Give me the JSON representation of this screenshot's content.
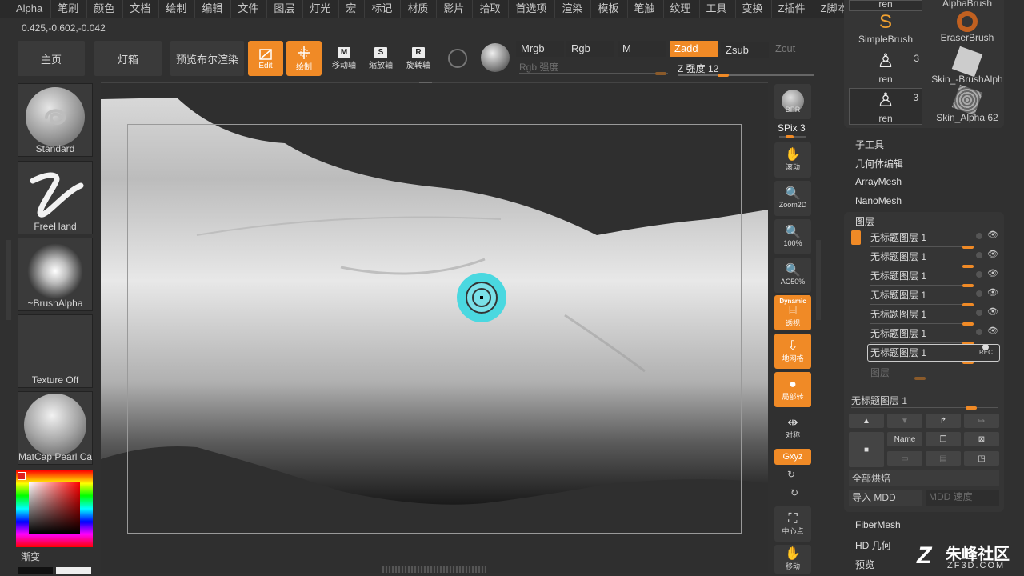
{
  "menu": [
    "Alpha",
    "笔刷",
    "颜色",
    "文档",
    "绘制",
    "编辑",
    "文件",
    "图层",
    "灯光",
    "宏",
    "标记",
    "材质",
    "影片",
    "拾取",
    "首选项",
    "渲染",
    "模板",
    "笔触",
    "纹理",
    "工具",
    "变换",
    "Z插件",
    "Z脚本"
  ],
  "coords": "0.425,-0.602,-0.042",
  "top": {
    "home": "主页",
    "lightbox": "灯箱",
    "preview": "预览布尔渲染",
    "edit": "Edit",
    "draw": "绘制",
    "move": "移动轴",
    "scale": "缩放轴",
    "rotate": "旋转轴"
  },
  "channels": {
    "mrgb": "Mrgb",
    "rgb": "Rgb",
    "m": "M",
    "zadd": "Zadd",
    "zsub": "Zsub",
    "zcut": "Zcut",
    "rgb_intensity": "Rgb 强度",
    "z_intensity_label": "Z 强度 12",
    "z_intensity": 12
  },
  "left": {
    "brush": "Standard",
    "stroke": "FreeHand",
    "alpha": "~BrushAlpha",
    "texture": "Texture Off",
    "material": "MatCap Pearl Ca",
    "gradient": "渐变"
  },
  "rtools": {
    "bpr": "BPR",
    "spix": "SPix 3",
    "scroll": "滚动",
    "zoom2d": "Zoom2D",
    "actual": "100%",
    "ac50": "AC50%",
    "dynamic": "Dynamic",
    "persp": "透视",
    "floor": "地网格",
    "local": "局部转",
    "sym": "对称",
    "xyz": "Gxyz",
    "center": "中心点",
    "move": "移动"
  },
  "brushes": [
    {
      "name": "ren",
      "count": ""
    },
    {
      "name": "AlphaBrush",
      "count": ""
    },
    {
      "name": "SimpleBrush",
      "count": ""
    },
    {
      "name": "EraserBrush",
      "count": ""
    },
    {
      "name": "ren",
      "count": "3"
    },
    {
      "name": "Skin_-BrushAlph",
      "count": ""
    },
    {
      "name": "ren",
      "count": "3"
    },
    {
      "name": "Skin_Alpha 62",
      "count": ""
    }
  ],
  "tool_menu": [
    "子工具",
    "几何体编辑",
    "ArrayMesh",
    "NanoMesh"
  ],
  "layers_title": "图层",
  "layers": [
    "无标题图层 1",
    "无标题图层 1",
    "无标题图层 1",
    "无标题图层 1",
    "无标题图层 1",
    "无标题图层 1",
    "无标题图层 1"
  ],
  "layer_slider": "图层",
  "layer_current": "无标题图层 1",
  "layer_rec": "REC",
  "layer_name_btn": "Name",
  "bake_all": "全部烘焙",
  "import_mdd": "导入 MDD",
  "mdd_speed": "MDD 速度",
  "bottom_menu": [
    "FiberMesh",
    "HD 几何",
    "预览"
  ],
  "watermark": {
    "brand": "朱峰社区",
    "url": "ZF3D.COM"
  },
  "colors": {
    "accent": "#f08a26",
    "cursor": "#4ad8e0"
  }
}
